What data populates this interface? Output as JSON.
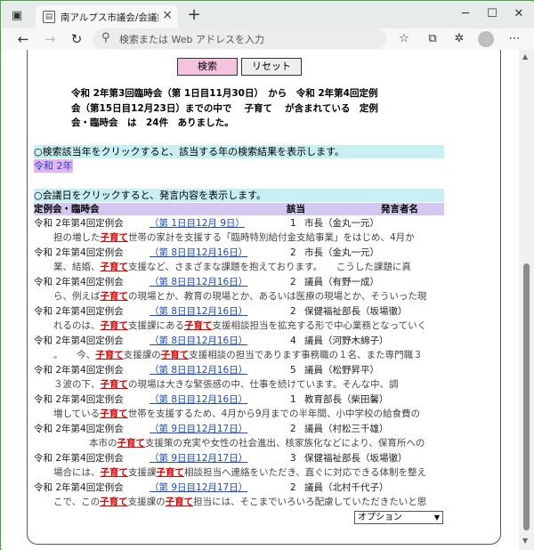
{
  "browser": {
    "tab_title": "南アルプス市議会/会議録検索シス",
    "address_placeholder": "検索または Web アドレスを入力",
    "new_tab": "+",
    "tab_close": "×"
  },
  "form": {
    "search_label": "検索",
    "reset_label": "リセット"
  },
  "summary": {
    "line1": "令和 2年第3回臨時会（第 1日目11月30日）　から　令和 2年第4回定例",
    "line2": "会（第15日目12月23日）までの中で　 子育て 　が含まれている　定例",
    "line3": "会・臨時会　は　24件　ありました。"
  },
  "year_instruction": "○検索該当年をクリックすると、該当する年の検索結果を表示します。",
  "year_link": "令和 2年",
  "meeting_instruction": "○会議日をクリックすると、発言内容を表示します。",
  "table": {
    "headers": [
      "定例会・臨時会",
      "該当",
      "発言者名"
    ],
    "keyword": "子育て",
    "rows": [
      {
        "session": "令和 2年第4回定例会",
        "date": "（第 1日目12月 9日）",
        "count": "1",
        "speaker": "市長（金丸一元）",
        "ex_a": "担の増した",
        "ex_b": "世帯の家計を支援する「臨時特別給付金支給事業」をはじめ、4月か",
        "ex_c": "",
        "ex_d": ""
      },
      {
        "session": "令和 2年第4回定例会",
        "date": "（第 8日目12月16日）",
        "count": "2",
        "speaker": "市長（金丸一元）",
        "ex_a": "業、結婚、",
        "ex_b": "支援など、さまざまな課題を抱えております。　　こうした課題に真",
        "ex_c": "",
        "ex_d": ""
      },
      {
        "session": "令和 2年第4回定例会",
        "date": "（第 8日目12月16日）",
        "count": "2",
        "speaker": "議員（有野一成）",
        "ex_a": "ら、例えば",
        "ex_b": "の現場とか、教育の現場とか、あるいは医療の現場とか、そういった現",
        "ex_c": "",
        "ex_d": ""
      },
      {
        "session": "令和 2年第4回定例会",
        "date": "（第 8日目12月16日）",
        "count": "2",
        "speaker": "保健福祉部長（坂場徹）",
        "ex_a": "れるのは、",
        "ex_b": "支援課にある",
        "ex_c": "支援相談担当を拡充する形で中心業務となっていく",
        "ex_d": ""
      },
      {
        "session": "令和 2年第4回定例会",
        "date": "（第 8日目12月16日）",
        "count": "4",
        "speaker": "議員（河野木綿子）",
        "ex_a": "。　　今、",
        "ex_b": "支援課の",
        "ex_c": "支援相談の担当であります事務職の１名、また専門職３",
        "ex_d": ""
      },
      {
        "session": "令和 2年第4回定例会",
        "date": "（第 8日目12月16日）",
        "count": "5",
        "speaker": "議員（松野昇平）",
        "ex_a": "３波の下、",
        "ex_b": "の現場は大きな緊張感の中、仕事を続けています。そんな中、調",
        "ex_c": "",
        "ex_d": ""
      },
      {
        "session": "令和 2年第4回定例会",
        "date": "（第 8日目12月16日）",
        "count": "1",
        "speaker": "教育部長（柴田馨）",
        "ex_a": "増している",
        "ex_b": "世帯を支援するため、4月から9月までの半年間、小中学校の給食費の",
        "ex_c": "",
        "ex_d": ""
      },
      {
        "session": "令和 2年第4回定例会",
        "date": "（第 9日目12月17日）",
        "count": "2",
        "speaker": "議員（村松三千雄）",
        "ex_a": "本市の",
        "ex_b": "支援策の充実や女性の社会進出、核家族化などにより、保育所への",
        "ex_c": "",
        "ex_d": ""
      },
      {
        "session": "令和 2年第4回定例会",
        "date": "（第 9日目12月17日）",
        "count": "3",
        "speaker": "保健福祉部長（坂場徹）",
        "ex_a": "場合には、",
        "ex_b": "支援課",
        "ex_c": "相談担当へ連絡をいただき、直ぐに対応できる体制を整え",
        "ex_d": ""
      },
      {
        "session": "令和 2年第4回定例会",
        "date": "（第 9日目12月17日）",
        "count": "2",
        "speaker": "議員（北村千代子）",
        "ex_a": "こで、この",
        "ex_b": "支援課の",
        "ex_c": "担当には、そこまでいろいろ配慮していただきたいと思",
        "ex_d": ""
      }
    ]
  },
  "options_label": "オプション"
}
